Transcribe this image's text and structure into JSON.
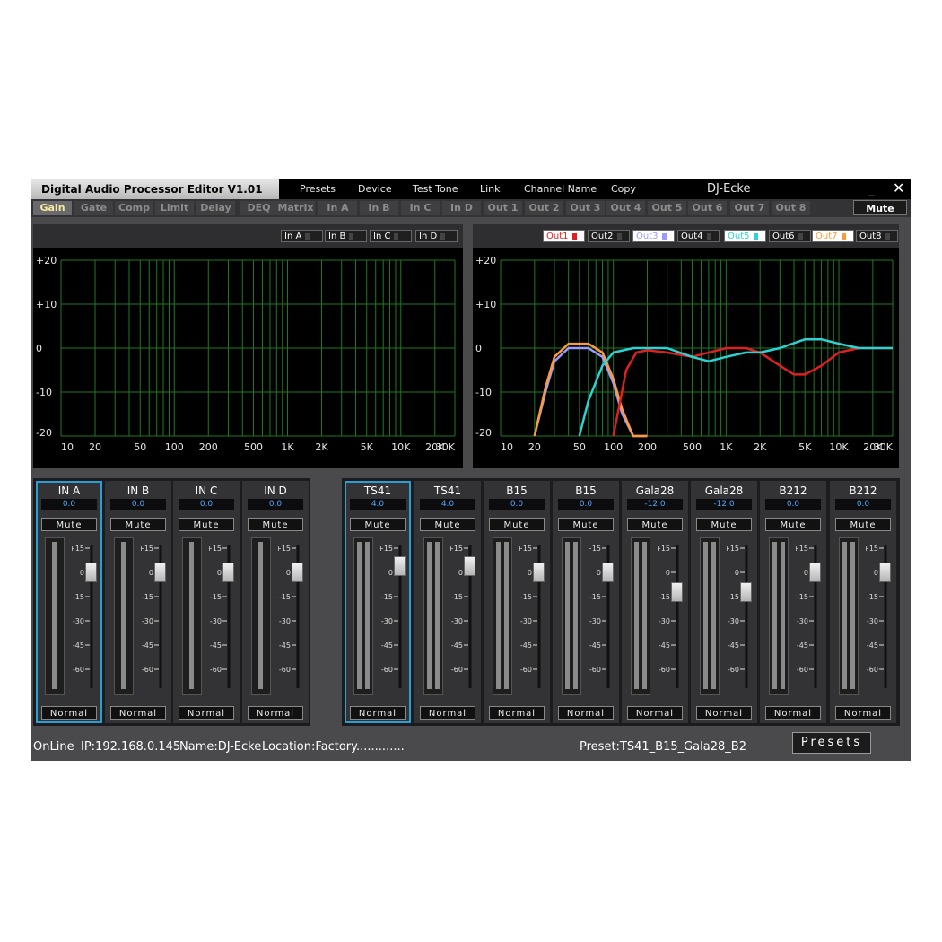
{
  "window": {
    "title": "Digital Audio Processor Editor  V1.01",
    "device_name": "DJ-Ecke",
    "minimize_label": "_",
    "close_label": "✕"
  },
  "menu": [
    "Presets",
    "Device",
    "Test Tone",
    "Link",
    "Channel Name",
    "Copy"
  ],
  "tabs": [
    "Gain",
    "Gate",
    "Comp",
    "Limit",
    "Delay",
    "DEQ",
    "Matrix",
    "In A",
    "In B",
    "In C",
    "In D",
    "Out 1",
    "Out 2",
    "Out 3",
    "Out 4",
    "Out 5",
    "Out 6",
    "Out 7",
    "Out 8"
  ],
  "active_tab": "Gain",
  "mute_all_label": "Mute",
  "input_graph": {
    "legend": [
      "In A",
      "In B",
      "In C",
      "In D"
    ],
    "y_ticks": [
      "+20",
      "+10",
      "0",
      "-10",
      "-20"
    ],
    "x_ticks": [
      "10",
      "20",
      "50",
      "100",
      "200",
      "500",
      "1K",
      "2K",
      "5K",
      "10K",
      "20K",
      "30K"
    ]
  },
  "output_graph": {
    "legend": [
      {
        "label": "Out1",
        "color": "#e02020",
        "bg": "#ffffff"
      },
      {
        "label": "Out2",
        "color": "#ffffff",
        "bg": "#1f1f1f"
      },
      {
        "label": "Out3",
        "color": "#9b9bff",
        "bg": "#ffffff"
      },
      {
        "label": "Out4",
        "color": "#ffffff",
        "bg": "#1f1f1f"
      },
      {
        "label": "Out5",
        "color": "#2ad4d4",
        "bg": "#ffffff"
      },
      {
        "label": "Out6",
        "color": "#ffffff",
        "bg": "#1f1f1f"
      },
      {
        "label": "Out7",
        "color": "#ff9a3a",
        "bg": "#ffffff"
      },
      {
        "label": "Out8",
        "color": "#ffffff",
        "bg": "#1f1f1f"
      }
    ],
    "y_ticks": [
      "+20",
      "+10",
      "0",
      "-10",
      "-20"
    ],
    "x_ticks": [
      "10",
      "20",
      "50",
      "100",
      "200",
      "500",
      "1K",
      "2K",
      "5K",
      "10K",
      "20K",
      "30K"
    ]
  },
  "chart_data": [
    {
      "type": "line",
      "title": "",
      "x_scale": "log",
      "xlim": [
        10,
        30000
      ],
      "ylim": [
        -20,
        20
      ],
      "grid": true,
      "series": []
    },
    {
      "type": "line",
      "title": "",
      "x_scale": "log",
      "xlim": [
        10,
        30000
      ],
      "ylim": [
        -20,
        20
      ],
      "grid": true,
      "series": [
        {
          "color": "#9b9bff",
          "x": [
            20,
            25,
            30,
            40,
            50,
            60,
            80,
            100,
            120,
            150,
            200
          ],
          "y": [
            -20,
            -10,
            -3,
            0,
            0,
            0,
            -2,
            -8,
            -15,
            -20,
            -20
          ]
        },
        {
          "color": "#ff9a3a",
          "x": [
            20,
            25,
            30,
            40,
            50,
            60,
            80,
            100,
            120,
            150,
            200
          ],
          "y": [
            -20,
            -9,
            -2,
            1,
            1,
            1,
            -1,
            -7,
            -14,
            -20,
            -20
          ]
        },
        {
          "color": "#e02020",
          "x": [
            100,
            130,
            160,
            200,
            300,
            500,
            700,
            1000,
            1500,
            2000,
            3000,
            4000,
            5000,
            7000,
            10000,
            15000,
            20000,
            30000
          ],
          "y": [
            -20,
            -5,
            -1,
            -0.5,
            -1,
            -2,
            -1,
            0,
            0,
            -1,
            -4,
            -6,
            -6,
            -4,
            -1,
            0,
            0,
            0
          ]
        },
        {
          "color": "#2ad4d4",
          "x": [
            50,
            60,
            80,
            100,
            150,
            200,
            300,
            500,
            700,
            1000,
            1500,
            2000,
            3000,
            5000,
            7000,
            10000,
            15000,
            20000,
            30000
          ],
          "y": [
            -20,
            -12,
            -4,
            -1,
            0,
            0,
            0,
            -2,
            -3,
            -2,
            -1,
            -1,
            0,
            2,
            2,
            1,
            0,
            0,
            0
          ]
        }
      ]
    }
  ],
  "inputs": [
    {
      "name": "IN A",
      "value": "0.0",
      "gain_db": 0,
      "selected": true
    },
    {
      "name": "IN B",
      "value": "0.0",
      "gain_db": 0,
      "selected": false
    },
    {
      "name": "IN C",
      "value": "0.0",
      "gain_db": 0,
      "selected": false
    },
    {
      "name": "IN D",
      "value": "0.0",
      "gain_db": 0,
      "selected": false
    }
  ],
  "outputs": [
    {
      "name": "TS41",
      "value": "4.0",
      "gain_db": 4,
      "selected": true
    },
    {
      "name": "TS41",
      "value": "4.0",
      "gain_db": 4,
      "selected": false
    },
    {
      "name": "B15",
      "value": "0.0",
      "gain_db": 0,
      "selected": false
    },
    {
      "name": "B15",
      "value": "0.0",
      "gain_db": 0,
      "selected": false
    },
    {
      "name": "Gala28",
      "value": "-12.0",
      "gain_db": -12,
      "selected": false
    },
    {
      "name": "Gala28",
      "value": "-12.0",
      "gain_db": -12,
      "selected": false
    },
    {
      "name": "B212",
      "value": "0.0",
      "gain_db": 0,
      "selected": false
    },
    {
      "name": "B212",
      "value": "0.0",
      "gain_db": 0,
      "selected": false
    }
  ],
  "strip_labels": {
    "mute": "Mute",
    "normal": "Normal"
  },
  "fader_scale": [
    "+15",
    "0",
    "-15",
    "-30",
    "-45",
    "-60"
  ],
  "status": {
    "online": "OnLine",
    "ip": "IP:192.168.0.145",
    "name": "Name:DJ-Ecke",
    "location": "Location:Factory.............",
    "preset": "Preset:TS41_B15_Gala28_B2",
    "presets_button": "Presets"
  }
}
